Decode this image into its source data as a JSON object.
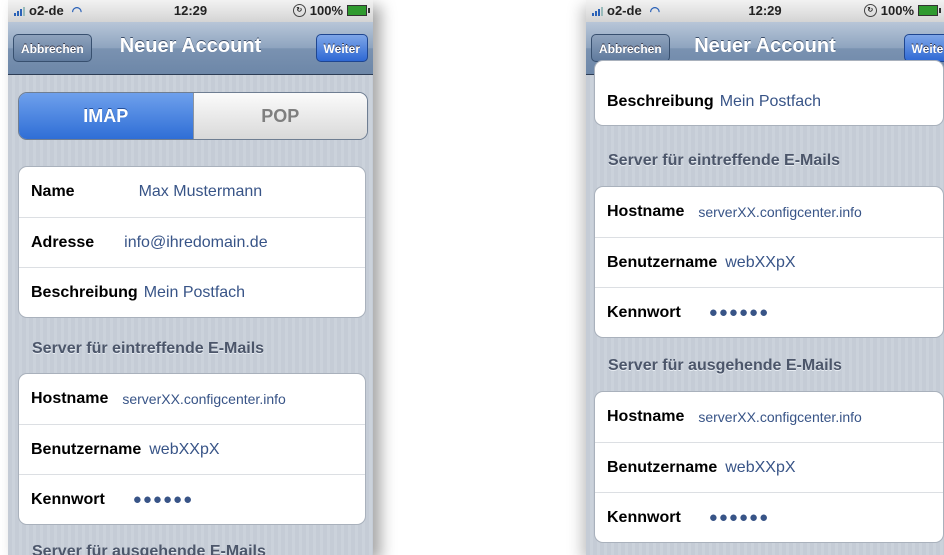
{
  "status": {
    "carrier": "o2-de",
    "time": "12:29",
    "battery": "100%"
  },
  "nav": {
    "cancel": "Abbrechen",
    "title": "Neuer Account",
    "next": "Weiter"
  },
  "segment": {
    "imap": "IMAP",
    "pop": "POP"
  },
  "account": {
    "name_label": "Name",
    "name_value": "Max Mustermann",
    "address_label": "Adresse",
    "address_value": "info@ihredomain.de",
    "desc_label": "Beschreibung",
    "desc_value": "Mein Postfach"
  },
  "incoming": {
    "header": "Server für eintreffende E-Mails",
    "host_label": "Hostname",
    "host_value": "serverXX.configcenter.info",
    "user_label": "Benutzername",
    "user_value": "webXXpX",
    "pass_label": "Kennwort",
    "pass_value": "●●●●●●"
  },
  "outgoing": {
    "header": "Server für ausgehende E-Mails",
    "host_label": "Hostname",
    "host_value": "serverXX.configcenter.info",
    "user_label": "Benutzername",
    "user_value": "webXXpX",
    "pass_label": "Kennwort",
    "pass_value": "●●●●●●"
  }
}
